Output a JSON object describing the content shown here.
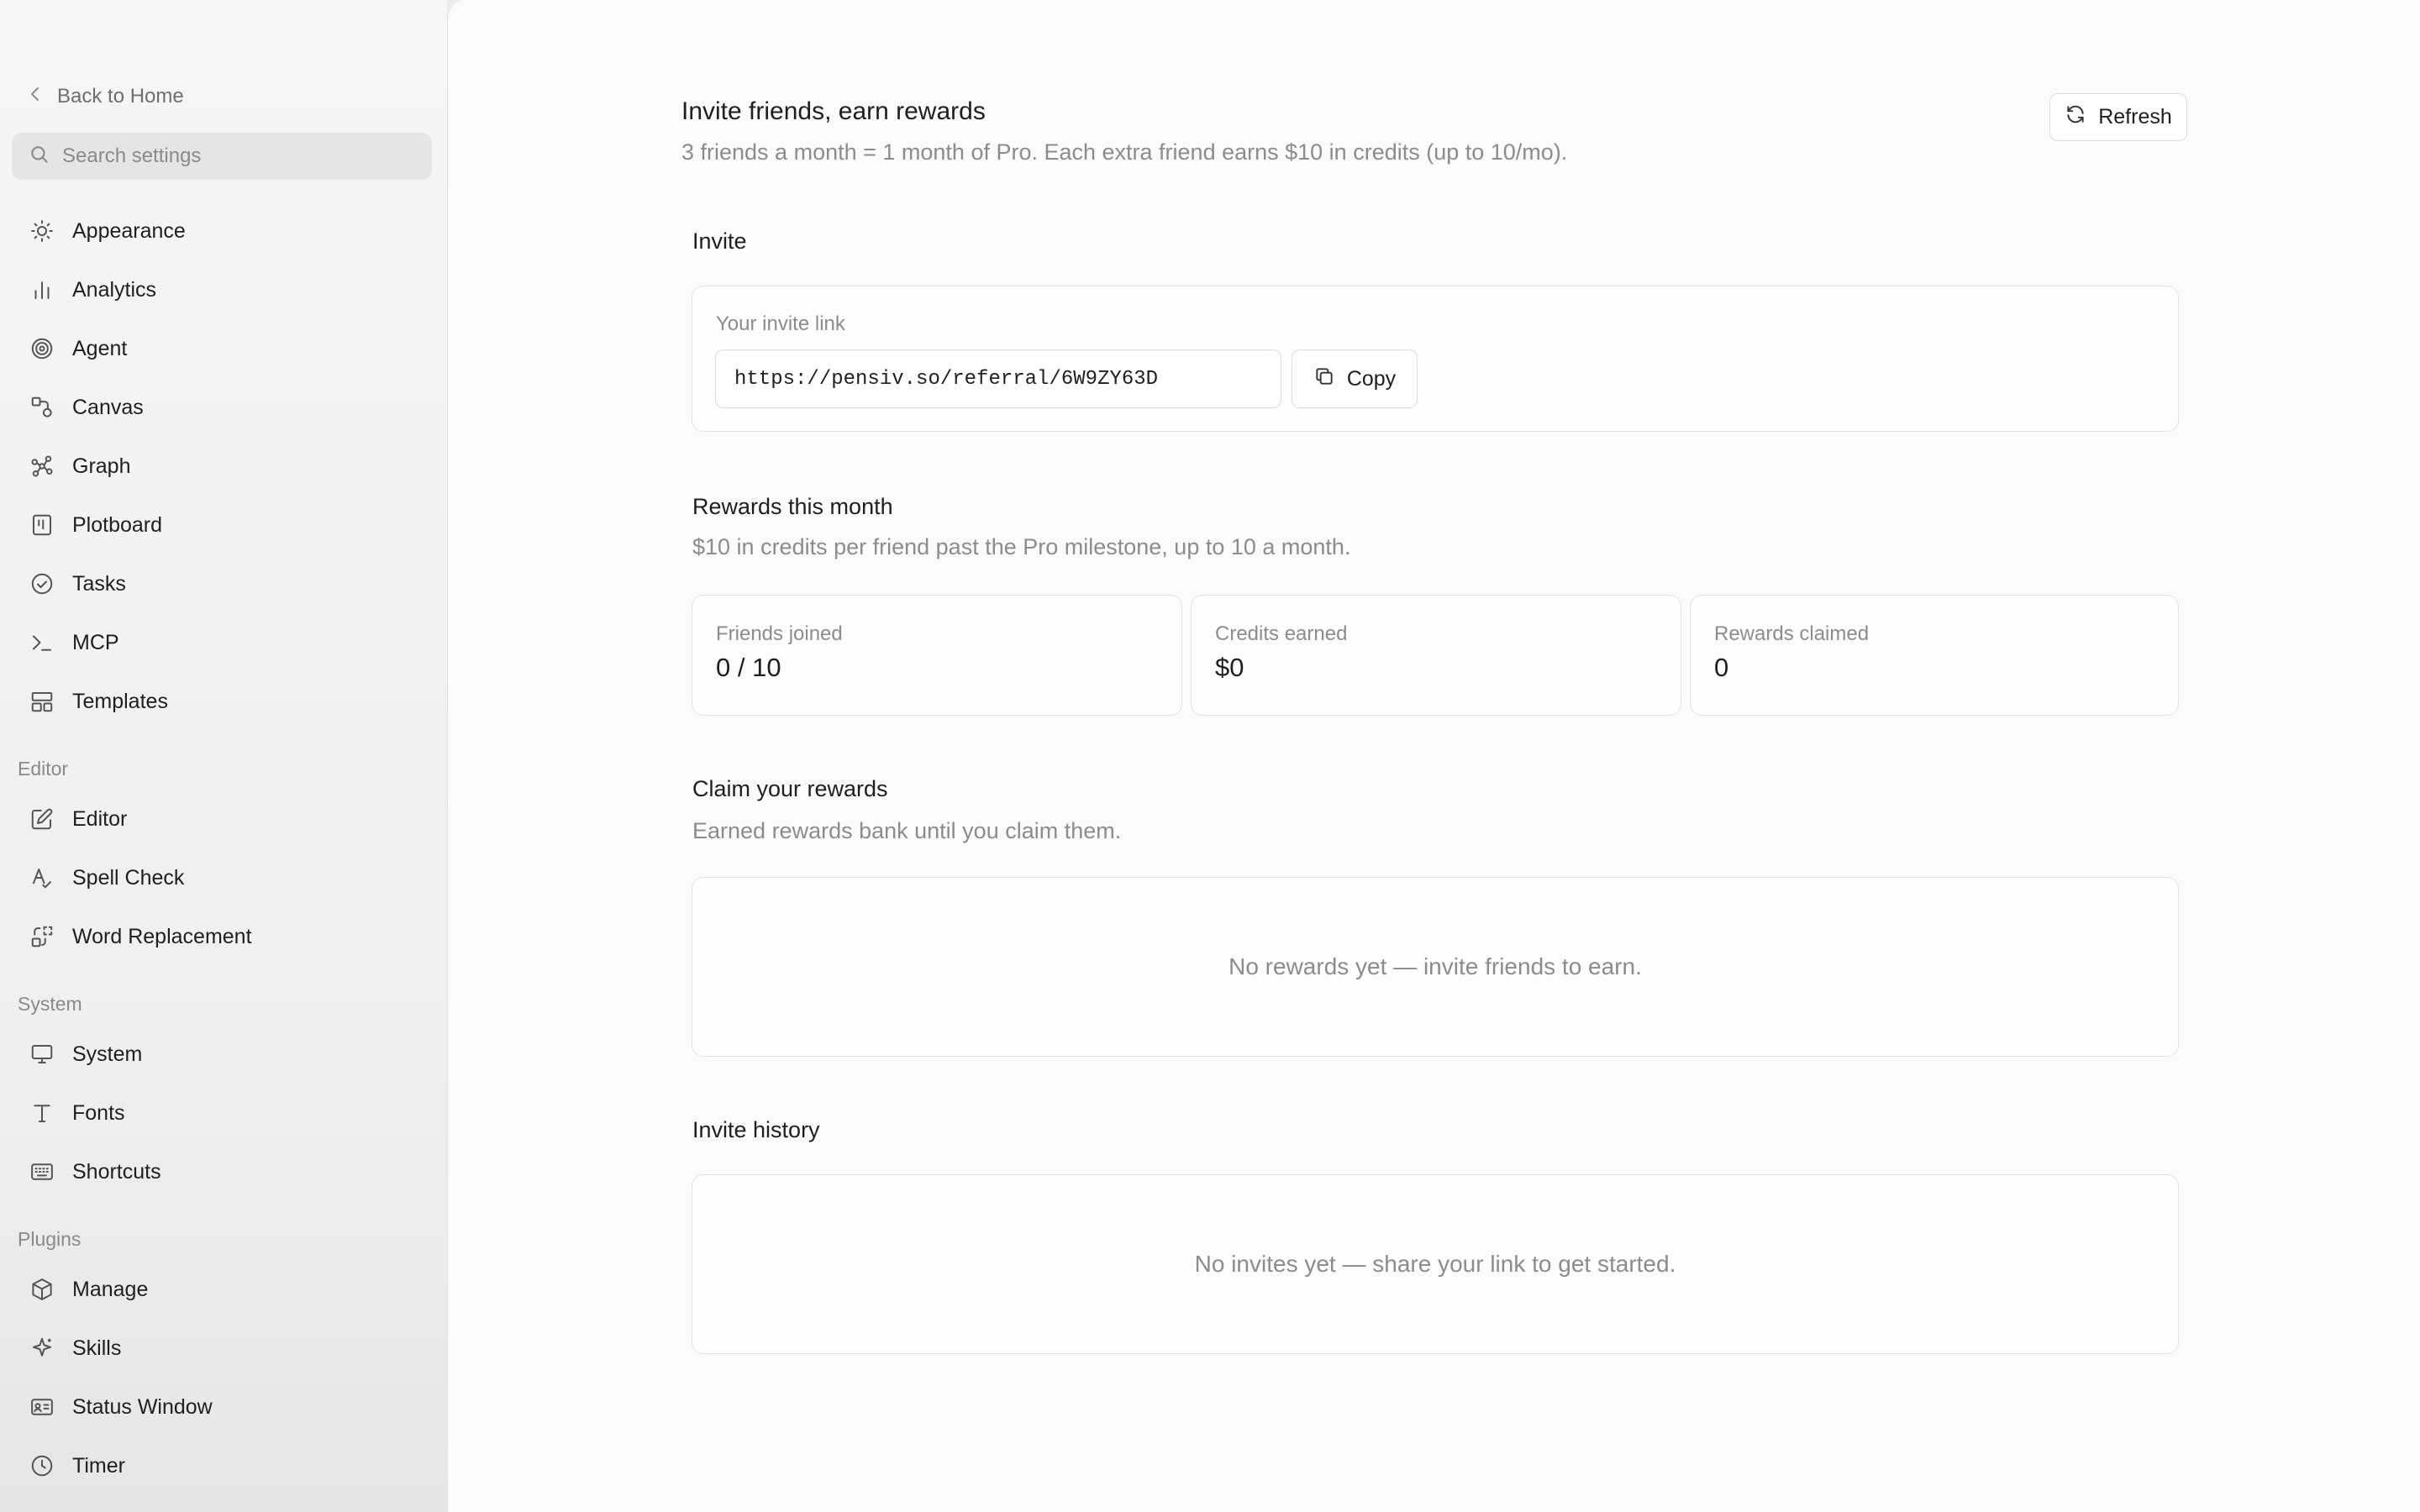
{
  "sidebar": {
    "back_label": "Back to Home",
    "search_placeholder": "Search settings",
    "items": [
      {
        "label": "Appearance",
        "icon": "sun-icon"
      },
      {
        "label": "Analytics",
        "icon": "bar-chart-icon"
      },
      {
        "label": "Agent",
        "icon": "spiral-icon"
      },
      {
        "label": "Canvas",
        "icon": "shapes-icon"
      },
      {
        "label": "Graph",
        "icon": "graph-nodes-icon"
      },
      {
        "label": "Plotboard",
        "icon": "board-icon"
      },
      {
        "label": "Tasks",
        "icon": "check-circle-icon"
      },
      {
        "label": "MCP",
        "icon": "terminal-icon"
      },
      {
        "label": "Templates",
        "icon": "layout-icon"
      }
    ],
    "sections": [
      {
        "label": "Editor",
        "items": [
          {
            "label": "Editor",
            "icon": "edit-icon"
          },
          {
            "label": "Spell Check",
            "icon": "spell-check-icon"
          },
          {
            "label": "Word Replacement",
            "icon": "replace-icon"
          }
        ]
      },
      {
        "label": "System",
        "items": [
          {
            "label": "System",
            "icon": "monitor-icon"
          },
          {
            "label": "Fonts",
            "icon": "type-icon"
          },
          {
            "label": "Shortcuts",
            "icon": "keyboard-icon"
          }
        ]
      },
      {
        "label": "Plugins",
        "items": [
          {
            "label": "Manage",
            "icon": "package-icon"
          },
          {
            "label": "Skills",
            "icon": "sparkle-icon"
          },
          {
            "label": "Status Window",
            "icon": "id-card-icon"
          },
          {
            "label": "Timer",
            "icon": "clock-icon"
          }
        ]
      }
    ]
  },
  "main": {
    "title": "Invite friends, earn rewards",
    "subtitle": "3 friends a month = 1 month of Pro. Each extra friend earns $10 in credits (up to 10/mo).",
    "refresh_label": "Refresh",
    "invite": {
      "heading": "Invite",
      "link_label": "Your invite link",
      "link_value": "https://pensiv.so/referral/6W9ZY63D",
      "copy_label": "Copy"
    },
    "rewards": {
      "heading": "Rewards this month",
      "description": "$10 in credits per friend past the Pro milestone, up to 10 a month.",
      "stats": [
        {
          "label": "Friends joined",
          "value": "0 / 10"
        },
        {
          "label": "Credits earned",
          "value": "$0"
        },
        {
          "label": "Rewards claimed",
          "value": "0"
        }
      ]
    },
    "claim": {
      "heading": "Claim your rewards",
      "description": "Earned rewards bank until you claim them.",
      "empty_text": "No rewards yet — invite friends to earn."
    },
    "history": {
      "heading": "Invite history",
      "empty_text": "No invites yet — share your link to get started."
    }
  }
}
